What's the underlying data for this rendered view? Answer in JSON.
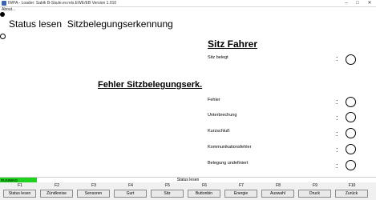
{
  "window": {
    "title": "IWPA - Loader: Sabik B-Säule.ev.rels.EWE/EB Version 1.010",
    "menu": [
      "About..."
    ]
  },
  "page": {
    "title": "Status lesen  Sitzbelegungserkennung"
  },
  "section_driver": {
    "title": "Sitz Fahrer",
    "items": [
      {
        "label": "Sitz belegt",
        "sep": ":"
      }
    ]
  },
  "section_errors": {
    "title": "Fehler Sitzbelegungserk.",
    "items": [
      {
        "label": "Fehler",
        "sep": ":"
      },
      {
        "label": "Unterbrechung",
        "sep": ":"
      },
      {
        "label": "Kurzschluß",
        "sep": ":"
      },
      {
        "label": "Kommunikationsfehler",
        "sep": ":"
      },
      {
        "label": "Belegung undefiniert",
        "sep": ":"
      }
    ]
  },
  "statusbar": {
    "state": "RUNNING",
    "text": "Status lesen",
    "state_color": "#1ed11e"
  },
  "function_keys": [
    {
      "key": "F1",
      "label": "Status lesen"
    },
    {
      "key": "F2",
      "label": "Zündkreise"
    },
    {
      "key": "F3",
      "label": "Sensoren"
    },
    {
      "key": "F4",
      "label": "Gurt"
    },
    {
      "key": "F5",
      "label": "Sitz"
    },
    {
      "key": "F6",
      "label": "Buttonbin"
    },
    {
      "key": "F7",
      "label": "Energie"
    },
    {
      "key": "F8",
      "label": "Auswahl"
    },
    {
      "key": "F9",
      "label": "Druck"
    },
    {
      "key": "F10",
      "label": "Zurück"
    }
  ]
}
